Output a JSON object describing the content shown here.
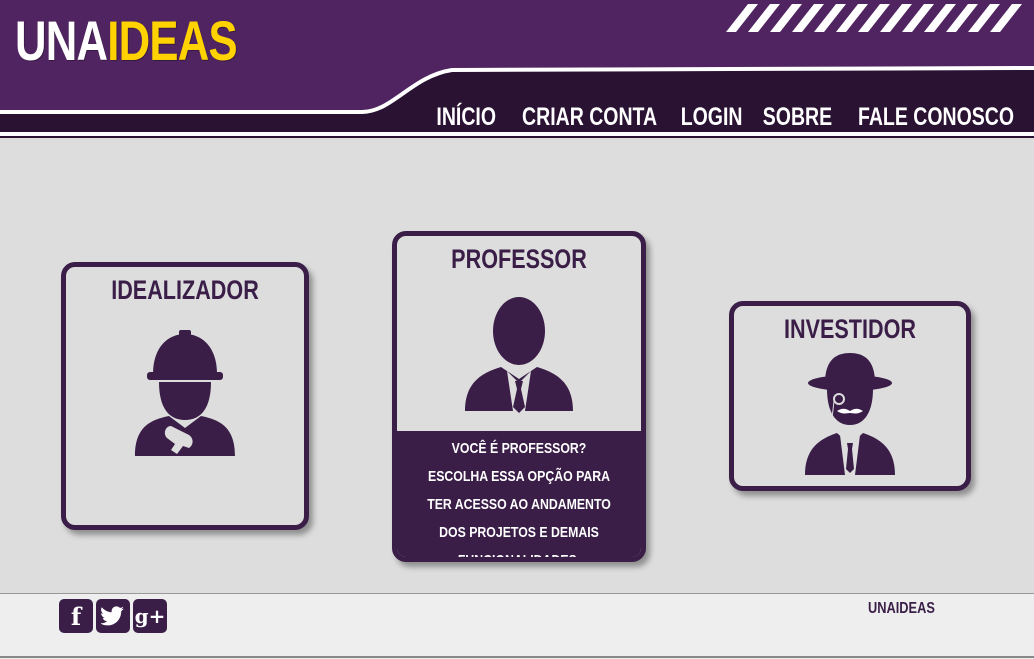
{
  "header": {
    "logo_part1": "UNA",
    "logo_part2": "IDEAS",
    "nav": [
      "INÍCIO",
      "CRIAR CONTA",
      "LOGIN",
      "SOBRE",
      "FALE CONOSCO"
    ]
  },
  "cards": {
    "idealizador": {
      "title": "IDEALIZADOR"
    },
    "professor": {
      "title": "PROFESSOR",
      "description": "VOCÊ É PROFESSOR? ESCOLHA ESSA OPÇÃO PARA TER ACESSO AO ANDAMENTO DOS PROJETOS E DEMAIS FUNCIONALIDADES."
    },
    "investidor": {
      "title": "INVESTIDOR"
    }
  },
  "footer": {
    "brand": "UNAIDEAS",
    "social": [
      "facebook-icon",
      "twitter-icon",
      "google-plus-icon"
    ]
  },
  "colors": {
    "primary": "#3a1e48",
    "header": "#4f2460",
    "accent": "#ffd200",
    "background": "#dddddd"
  }
}
